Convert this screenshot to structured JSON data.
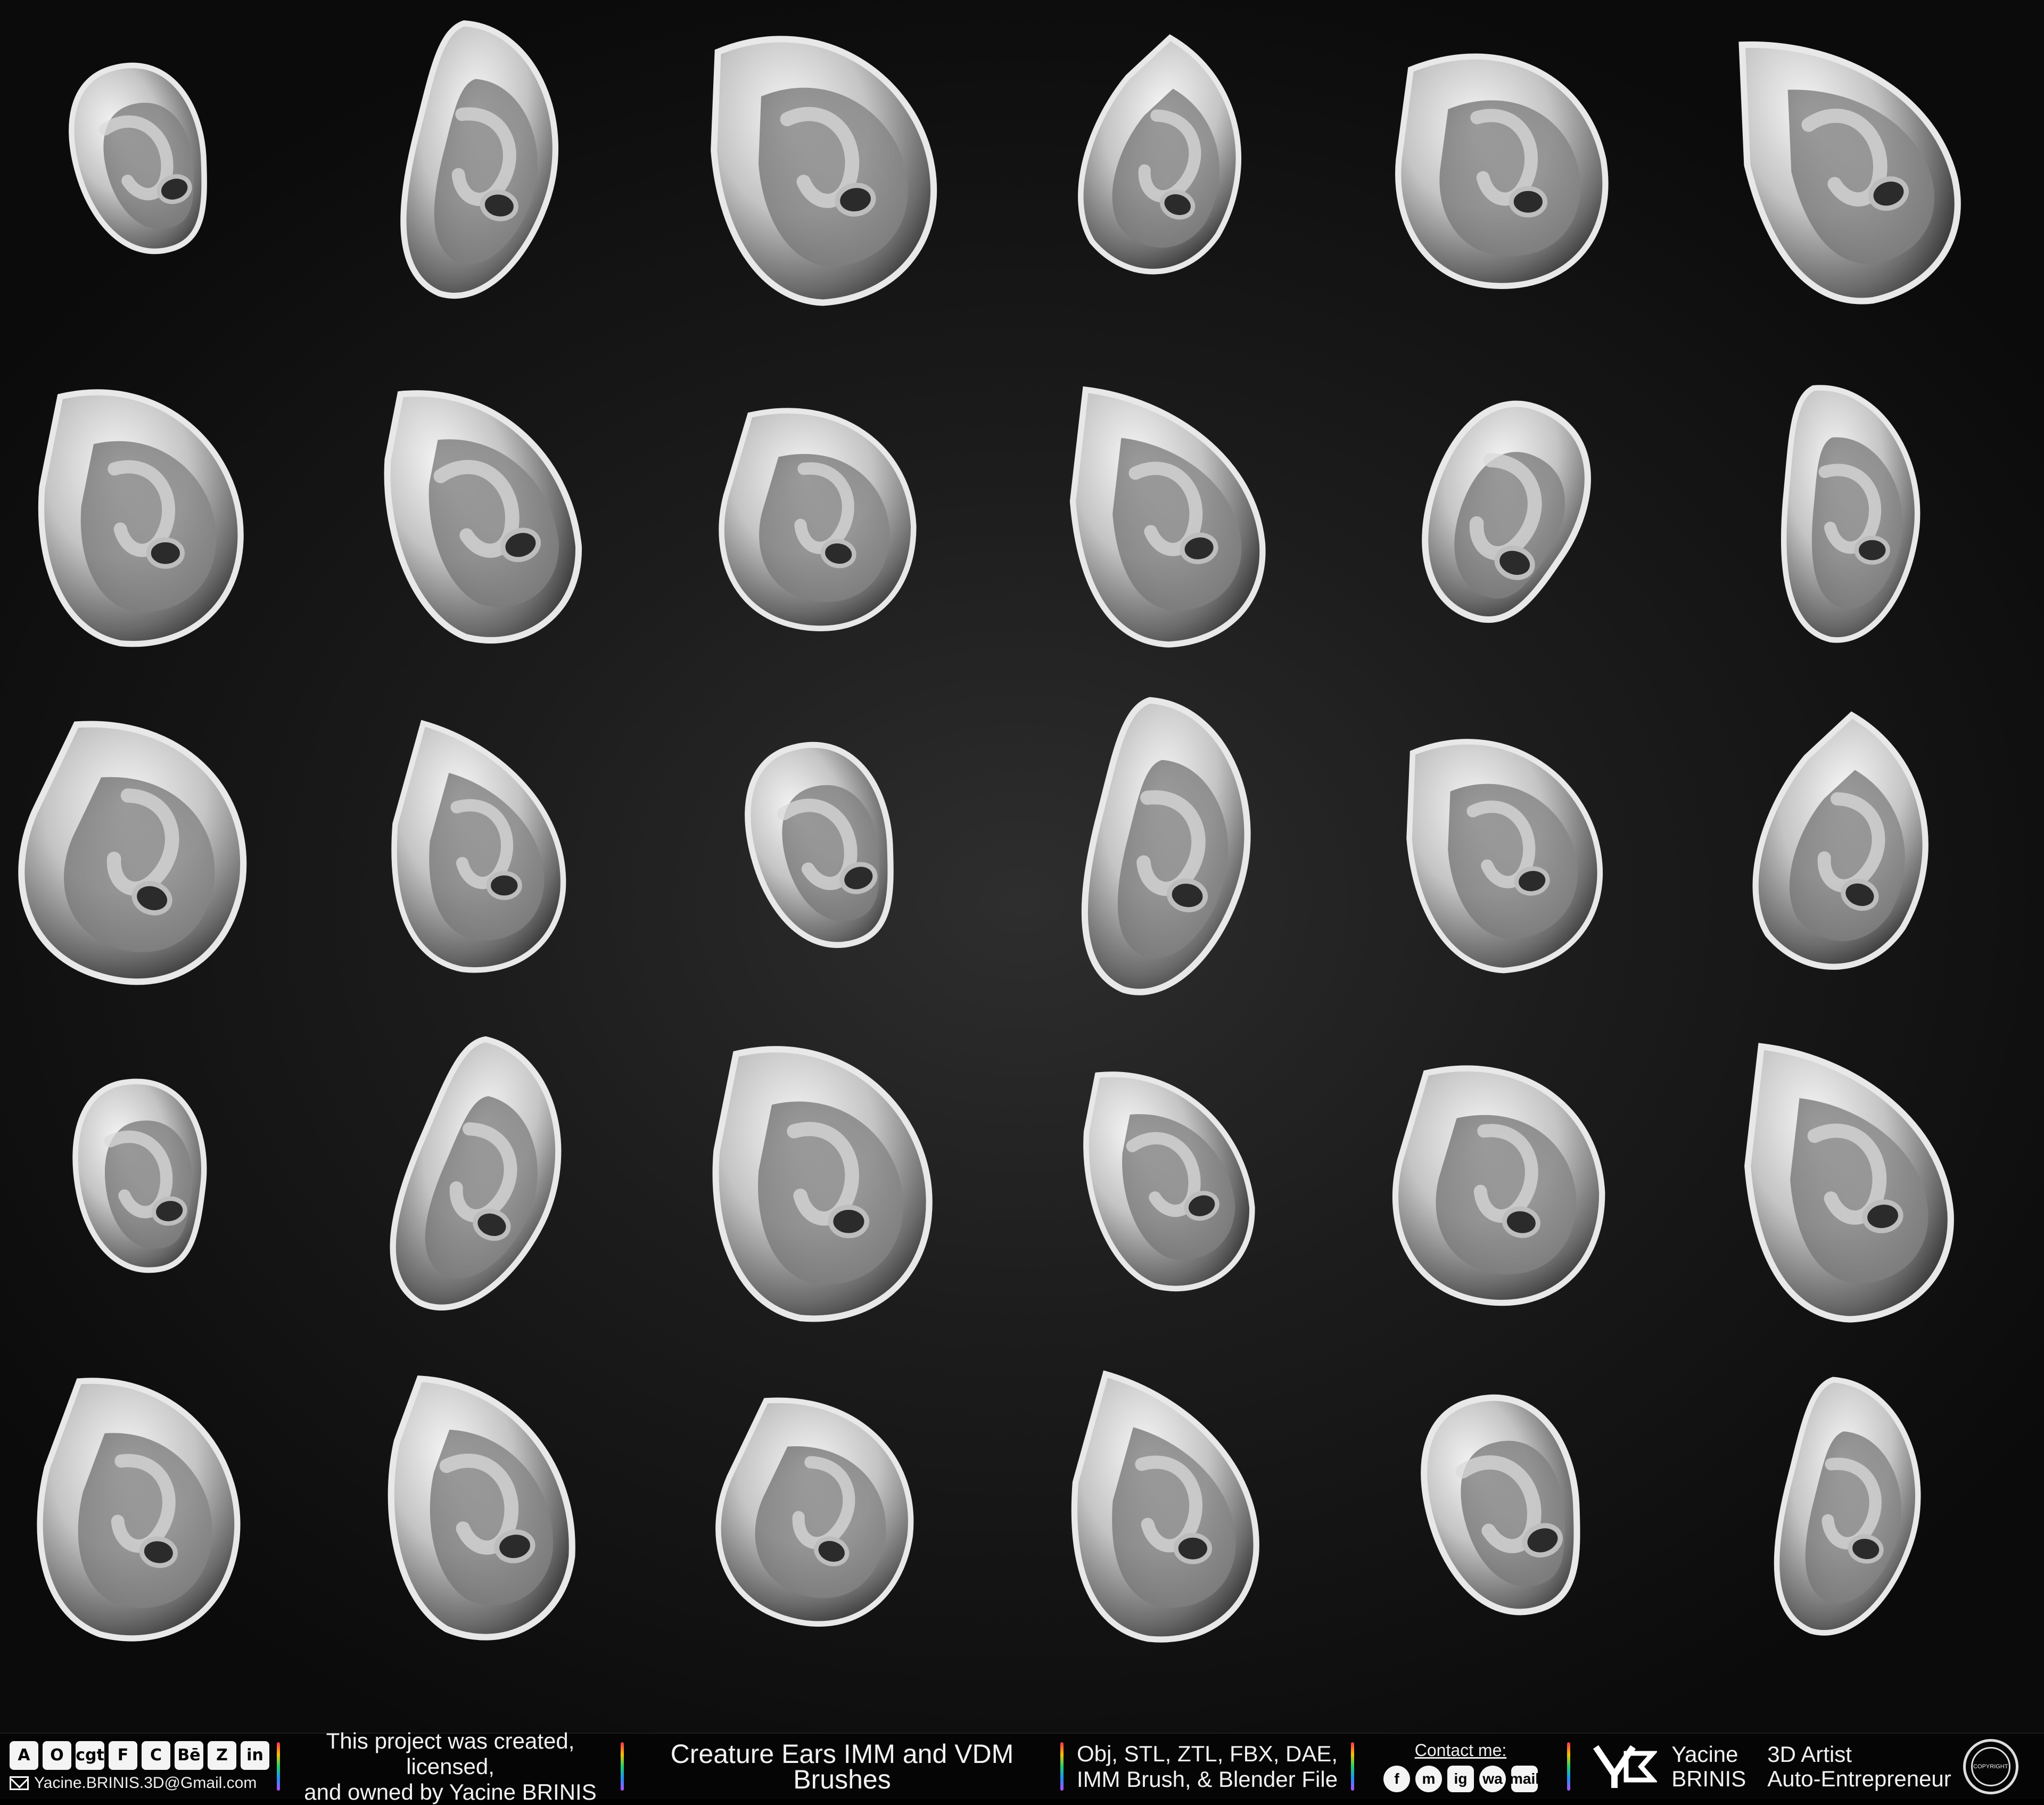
{
  "footer": {
    "social_icons": [
      "A",
      "O",
      "cgt",
      "F",
      "C",
      "Bē",
      "Z",
      "in"
    ],
    "email": "Yacine.BRINIS.3D@Gmail.com",
    "ownership_line1": "This project was created, licensed,",
    "ownership_line2": "and owned by Yacine BRINIS",
    "product_title": "Creature Ears IMM and VDM Brushes",
    "formats_line1": "Obj, STL, ZTL, FBX, DAE,",
    "formats_line2": "IMM Brush, & Blender File",
    "contact_title": "Contact me:",
    "contact_icons": [
      "f",
      "m",
      "ig",
      "wa",
      "mail"
    ],
    "author_first": "Yacine",
    "author_last": "BRINIS",
    "role_line1": "3D Artist",
    "role_line2": "Auto-Entrepreneur",
    "seal_text": "COPYRIGHT"
  },
  "grid": {
    "rows": 5,
    "columns": 6
  },
  "colors": {
    "background": "#1c1c1c",
    "ear_light": "#f2f2f2",
    "ear_dark": "#2a2a2a",
    "footer_bg": "#050505"
  }
}
